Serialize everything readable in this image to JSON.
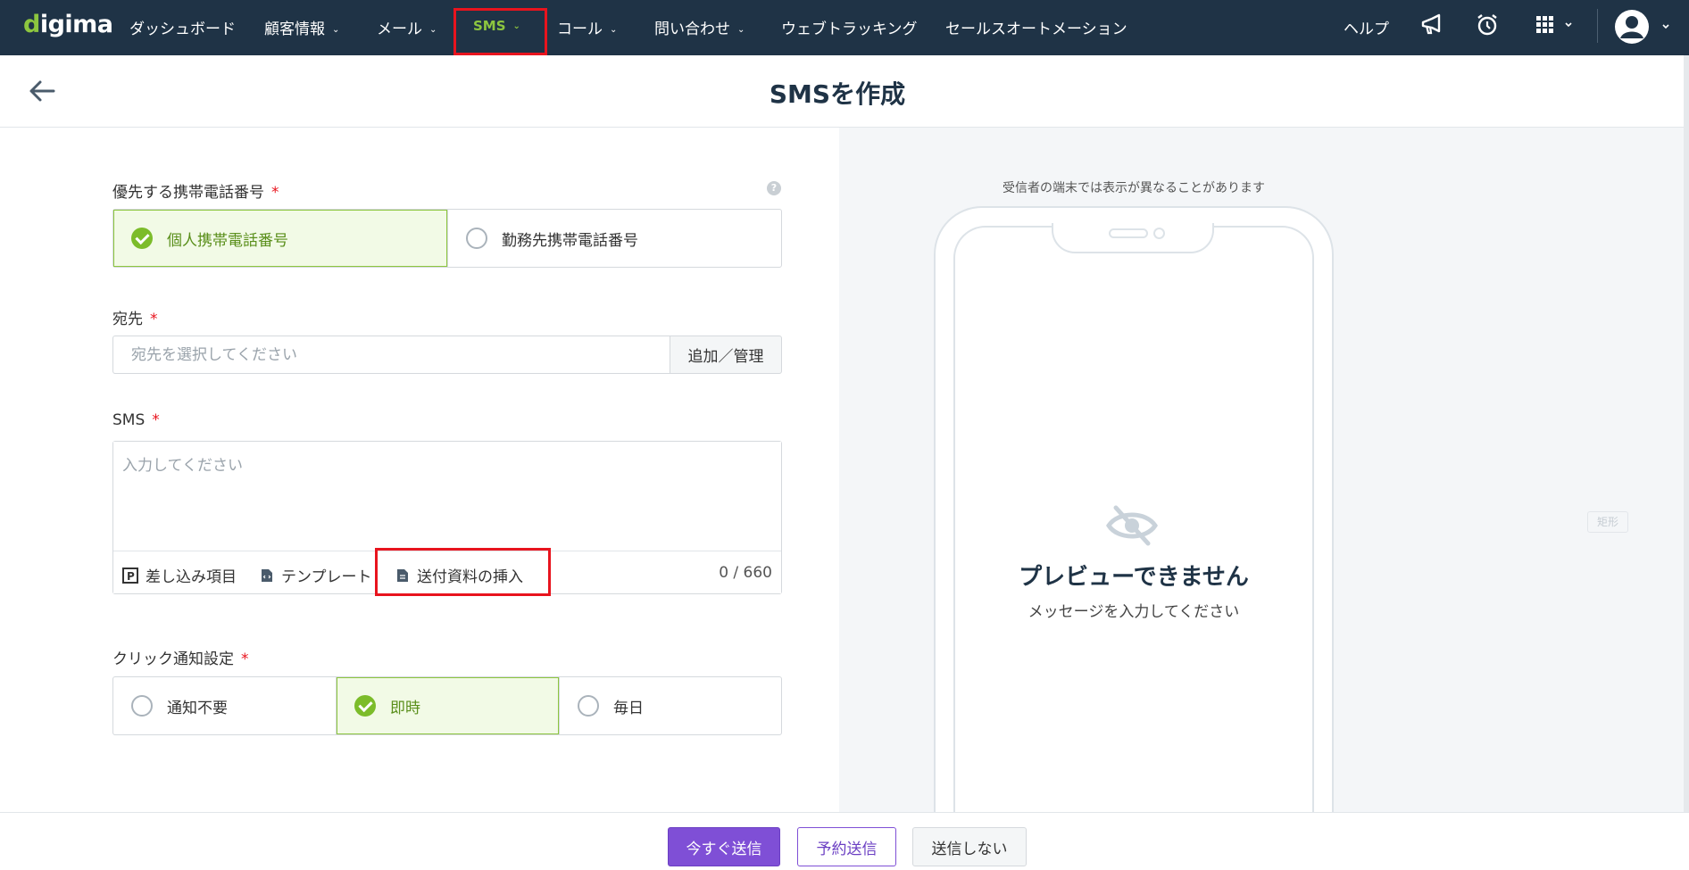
{
  "nav": {
    "logo": "digima",
    "items": [
      {
        "label": "ダッシュボード"
      },
      {
        "label": "顧客情報"
      },
      {
        "label": "メール"
      },
      {
        "label": "SMS"
      },
      {
        "label": "コール"
      },
      {
        "label": "問い合わせ"
      },
      {
        "label": "ウェブトラッキング"
      },
      {
        "label": "セールスオートメーション"
      }
    ],
    "help": "ヘルプ",
    "icons": [
      "megaphone-icon",
      "alarm-clock-icon",
      "apps-grid-icon",
      "user-avatar-icon"
    ]
  },
  "page": {
    "title": "SMSを作成"
  },
  "form": {
    "phone_priority": {
      "label": "優先する携帯電話番号",
      "required": "*",
      "options": [
        "個人携帯電話番号",
        "勤務先携帯電話番号"
      ],
      "selected": "個人携帯電話番号"
    },
    "recipient": {
      "label": "宛先",
      "required": "*",
      "placeholder": "宛先を選択してください",
      "button": "追加／管理"
    },
    "sms": {
      "label": "SMS",
      "required": "*",
      "placeholder": "入力してください",
      "tools": [
        "差し込み項目",
        "テンプレート",
        "送付資料の挿入"
      ],
      "counter": "0 / 660"
    },
    "click_notify": {
      "label": "クリック通知設定",
      "required": "*",
      "options": [
        "通知不要",
        "即時",
        "毎日"
      ],
      "selected": "即時"
    }
  },
  "preview": {
    "note": "受信者の端末では表示が異なることがあります",
    "title": "プレビューできません",
    "subtitle": "メッセージを入力してください",
    "ghost_tag": "矩形"
  },
  "footer": {
    "send_now": "今すぐ送信",
    "schedule": "予約送信",
    "no_send": "送信しない"
  },
  "colors": {
    "nav_bg": "#1f3346",
    "brand_green": "#8dc63f",
    "primary_purple": "#7f4fd6",
    "highlight_red": "#e8141e"
  }
}
